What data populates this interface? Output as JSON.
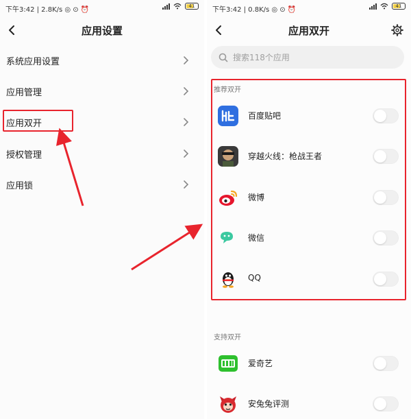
{
  "left": {
    "status": {
      "text": "下午3:42 | 2.8K/s ◎ ⊙ ⏰",
      "battery": "41"
    },
    "nav": {
      "title": "应用设置"
    },
    "menu": [
      {
        "label": "系统应用设置"
      },
      {
        "label": "应用管理"
      },
      {
        "label": "应用双开"
      },
      {
        "label": "授权管理"
      },
      {
        "label": "应用锁"
      }
    ]
  },
  "right": {
    "status": {
      "text": "下午3:42 | 0.8K/s ◎ ⊙ ⏰",
      "battery": "41"
    },
    "nav": {
      "title": "应用双开"
    },
    "search": {
      "placeholder": "搜索118个应用"
    },
    "sections": {
      "recommended": "推荐双开",
      "supported": "支持双开"
    },
    "recommended_apps": [
      {
        "label": "百度贴吧",
        "icon": "tieba-icon"
      },
      {
        "label": "穿越火线：枪战王者",
        "icon": "crossfire-icon"
      },
      {
        "label": "微博",
        "icon": "weibo-icon"
      },
      {
        "label": "微信",
        "icon": "wechat-icon"
      },
      {
        "label": "QQ",
        "icon": "qq-icon"
      }
    ],
    "supported_apps": [
      {
        "label": "爱奇艺",
        "icon": "iqiyi-icon"
      },
      {
        "label": "安兔兔评测",
        "icon": "antutu-icon"
      }
    ]
  },
  "colors": {
    "annotation_red": "#e8242d",
    "tieba_blue": "#2f6fe0",
    "weibo_red": "#e6162d",
    "wechat_green": "#3bc9a0",
    "iqiyi_green": "#2ec02e",
    "antutu_red": "#c8202a"
  }
}
